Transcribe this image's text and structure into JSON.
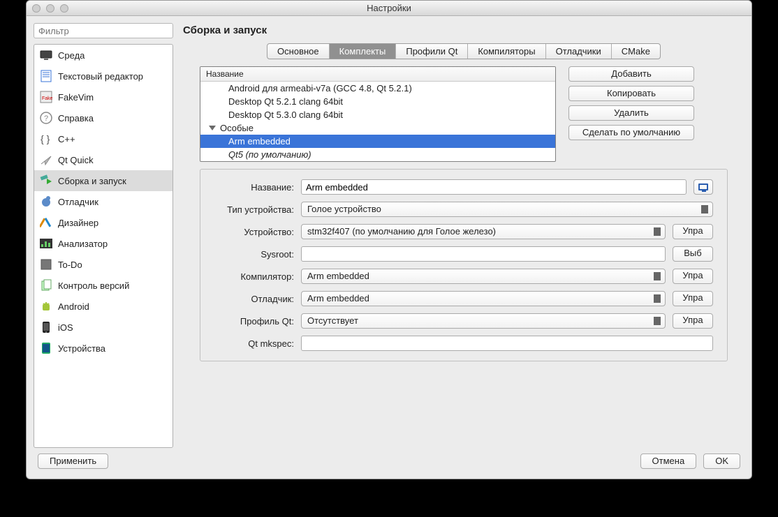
{
  "window_title": "Настройки",
  "filter_placeholder": "Фильтр",
  "page_title": "Сборка и запуск",
  "sidebar": [
    {
      "label": "Среда"
    },
    {
      "label": "Текстовый редактор"
    },
    {
      "label": "FakeVim"
    },
    {
      "label": "Справка"
    },
    {
      "label": "C++"
    },
    {
      "label": "Qt Quick"
    },
    {
      "label": "Сборка и запуск",
      "selected": true
    },
    {
      "label": "Отладчик"
    },
    {
      "label": "Дизайнер"
    },
    {
      "label": "Анализатор"
    },
    {
      "label": "To-Do"
    },
    {
      "label": "Контроль версий"
    },
    {
      "label": "Android"
    },
    {
      "label": "iOS"
    },
    {
      "label": "Устройства"
    }
  ],
  "tabs": [
    "Основное",
    "Комплекты",
    "Профили Qt",
    "Компиляторы",
    "Отладчики",
    "CMake"
  ],
  "active_tab": "Комплекты",
  "kits": {
    "header": "Название",
    "items": [
      "Android для armeabi-v7a (GCC 4.8, Qt 5.2.1)",
      "Desktop Qt 5.2.1 clang 64bit",
      "Desktop Qt 5.3.0 clang 64bit"
    ],
    "group": "Особые",
    "special": [
      {
        "label": "Arm embedded",
        "selected": true
      },
      {
        "label": "Qt5 (по умолчанию)",
        "italic": true
      }
    ]
  },
  "kit_buttons": {
    "add": "Добавить",
    "copy": "Копировать",
    "delete": "Удалить",
    "default": "Сделать по умолчанию"
  },
  "form": {
    "labels": {
      "name": "Название:",
      "device_type": "Тип устройства:",
      "device": "Устройство:",
      "sysroot": "Sysroot:",
      "compiler": "Компилятор:",
      "debugger": "Отладчик:",
      "qt_profile": "Профиль Qt:",
      "mkspec": "Qt mkspec:"
    },
    "values": {
      "name": "Arm embedded",
      "device_type": "Голое устройство",
      "device": "stm32f407 (по умолчанию для Голое железо)",
      "sysroot": "",
      "compiler": "Arm embedded",
      "debugger": "Arm embedded",
      "qt_profile": "Отсутствует",
      "mkspec": ""
    },
    "side_buttons": {
      "manage": "Упра",
      "choose": "Выб"
    }
  },
  "footer": {
    "apply": "Применить",
    "cancel": "Отмена",
    "ok": "OK"
  }
}
